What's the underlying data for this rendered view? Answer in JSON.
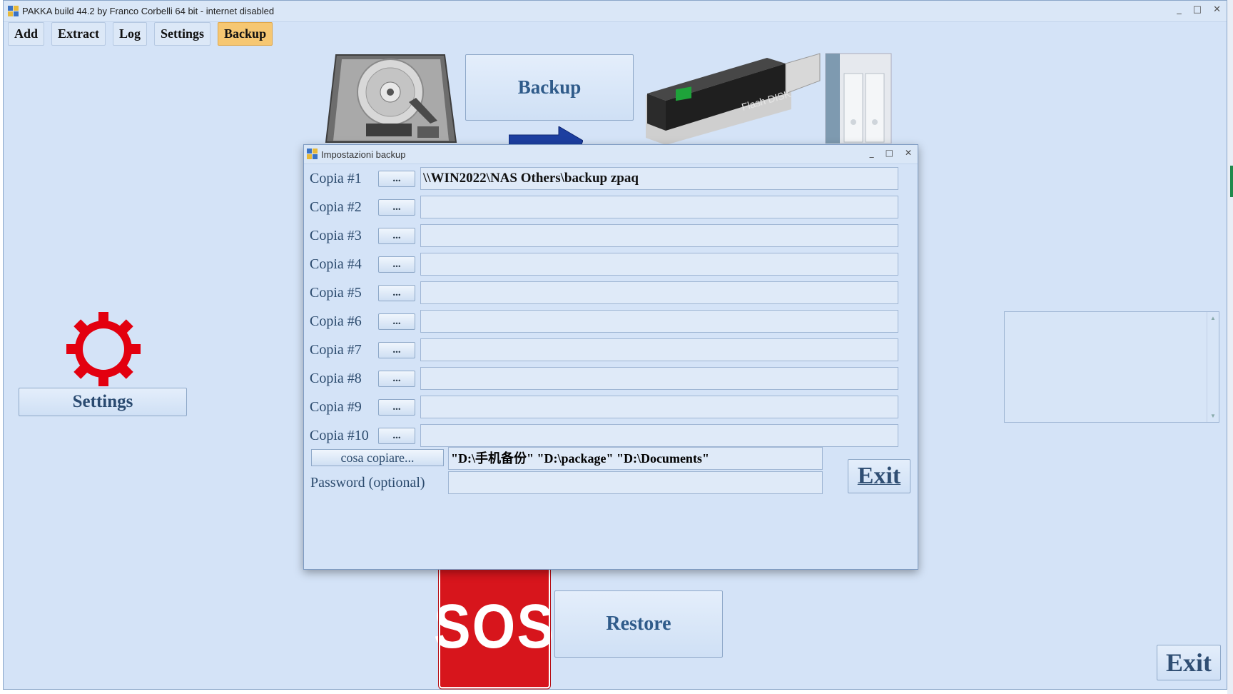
{
  "window": {
    "title": "PAKKA build 44.2 by Franco Corbelli 64 bit - internet disabled"
  },
  "tabs": [
    {
      "label": "Add"
    },
    {
      "label": "Extract"
    },
    {
      "label": "Log"
    },
    {
      "label": "Settings"
    },
    {
      "label": "Backup",
      "active": true
    }
  ],
  "main": {
    "backup_button": "Backup",
    "settings_button": "Settings",
    "sos_label": "SOS",
    "restore_button": "Restore",
    "exit_button": "Exit",
    "usb_brand": "Flash DISK"
  },
  "dialog": {
    "title": "Impostazioni backup",
    "browse_label": "...",
    "copies": [
      {
        "label": "Copia #1",
        "value": "\\\\WIN2022\\NAS Others\\backup zpaq"
      },
      {
        "label": "Copia #2",
        "value": ""
      },
      {
        "label": "Copia #3",
        "value": ""
      },
      {
        "label": "Copia #4",
        "value": ""
      },
      {
        "label": "Copia #5",
        "value": ""
      },
      {
        "label": "Copia #6",
        "value": ""
      },
      {
        "label": "Copia #7",
        "value": ""
      },
      {
        "label": "Copia #8",
        "value": ""
      },
      {
        "label": "Copia #9",
        "value": ""
      },
      {
        "label": "Copia #10",
        "value": ""
      }
    ],
    "what_to_copy_button": "cosa copiare...",
    "what_to_copy_value": "\"D:\\手机备份\" \"D:\\package\" \"D:\\Documents\"",
    "password_label": "Password (optional)",
    "password_value": "",
    "exit_button": "Exit"
  },
  "colors": {
    "window_bg": "#d4e3f7",
    "active_tab": "#f6c772",
    "button_text": "#2f5b8a",
    "sos_red": "#d7151c",
    "gear_red": "#e3000f"
  }
}
